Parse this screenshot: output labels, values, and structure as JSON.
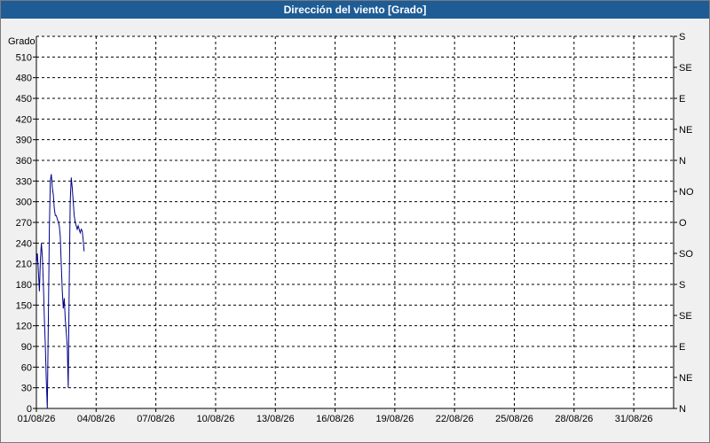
{
  "window": {
    "title": "Dirección del viento [Grado]"
  },
  "chart_data": {
    "type": "line",
    "title": "Dirección del viento [Grado]",
    "ylabel": "Grado",
    "ylim": [
      0,
      540
    ],
    "yticks": [
      0,
      30,
      60,
      90,
      120,
      150,
      180,
      210,
      240,
      270,
      300,
      330,
      360,
      390,
      420,
      450,
      480,
      510
    ],
    "xticks": [
      "01/08/26",
      "04/08/26",
      "07/08/26",
      "10/08/26",
      "13/08/26",
      "16/08/26",
      "19/08/26",
      "22/08/26",
      "25/08/26",
      "28/08/26",
      "31/08/26"
    ],
    "xlim_days": [
      1,
      33
    ],
    "right_axis": {
      "labels": [
        "N",
        "NE",
        "E",
        "SE",
        "S",
        "SO",
        "O",
        "NO",
        "N",
        "NE",
        "E",
        "SE",
        "S"
      ],
      "values": [
        0,
        45,
        90,
        135,
        180,
        225,
        270,
        315,
        360,
        405,
        450,
        495,
        540
      ]
    },
    "grid": true,
    "series": [
      {
        "color": "#00008b",
        "points": [
          [
            1.0,
            210
          ],
          [
            1.05,
            225
          ],
          [
            1.1,
            200
          ],
          [
            1.15,
            170
          ],
          [
            1.2,
            215
          ],
          [
            1.25,
            240
          ],
          [
            1.3,
            220
          ],
          [
            1.35,
            180
          ],
          [
            1.4,
            130
          ],
          [
            1.45,
            90
          ],
          [
            1.5,
            40
          ],
          [
            1.55,
            0
          ],
          [
            1.6,
            130
          ],
          [
            1.65,
            260
          ],
          [
            1.7,
            330
          ],
          [
            1.75,
            340
          ],
          [
            1.8,
            320
          ],
          [
            1.85,
            310
          ],
          [
            1.9,
            290
          ],
          [
            1.95,
            280
          ],
          [
            2.0,
            280
          ],
          [
            2.05,
            275
          ],
          [
            2.1,
            270
          ],
          [
            2.15,
            265
          ],
          [
            2.2,
            250
          ],
          [
            2.25,
            210
          ],
          [
            2.3,
            170
          ],
          [
            2.35,
            145
          ],
          [
            2.4,
            160
          ],
          [
            2.45,
            130
          ],
          [
            2.5,
            110
          ],
          [
            2.55,
            90
          ],
          [
            2.6,
            30
          ],
          [
            2.65,
            180
          ],
          [
            2.7,
            300
          ],
          [
            2.75,
            335
          ],
          [
            2.8,
            320
          ],
          [
            2.85,
            300
          ],
          [
            2.9,
            280
          ],
          [
            2.95,
            270
          ],
          [
            3.0,
            265
          ],
          [
            3.05,
            260
          ],
          [
            3.1,
            265
          ],
          [
            3.15,
            260
          ],
          [
            3.2,
            255
          ],
          [
            3.25,
            260
          ],
          [
            3.3,
            258
          ],
          [
            3.35,
            245
          ],
          [
            3.4,
            228
          ]
        ]
      }
    ]
  }
}
